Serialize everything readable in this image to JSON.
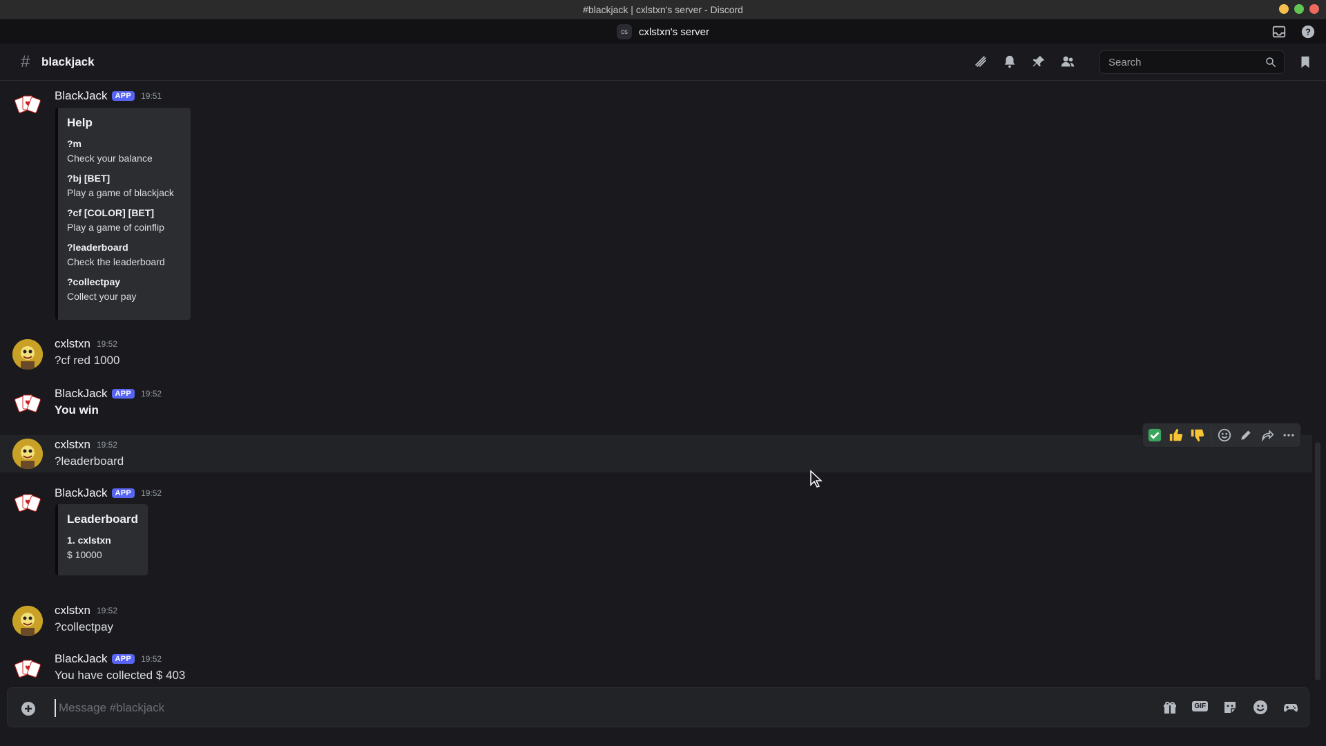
{
  "window": {
    "title": "#blackjack | cxlstxn's server - Discord"
  },
  "server": {
    "abbr": "cs",
    "name": "cxlstxn's server"
  },
  "channel": {
    "name": "blackjack"
  },
  "search": {
    "placeholder": "Search"
  },
  "composer": {
    "placeholder": "Message #blackjack"
  },
  "colors": {
    "accent": "#5865f2",
    "background": "#1a1a1e",
    "embed": "#2b2d31"
  },
  "messages": [
    {
      "author": "BlackJack",
      "badge": "APP",
      "time": "19:51",
      "embed": {
        "title": "Help",
        "fields": [
          {
            "name": "?m",
            "value": "Check your balance"
          },
          {
            "name": "?bj [BET]",
            "value": "Play a game of blackjack"
          },
          {
            "name": "?cf [COLOR] [BET]",
            "value": "Play a game of coinflip"
          },
          {
            "name": "?leaderboard",
            "value": "Check the leaderboard"
          },
          {
            "name": "?collectpay",
            "value": "Collect your pay"
          }
        ]
      }
    },
    {
      "author": "cxlstxn",
      "time": "19:52",
      "text": "?cf red 1000"
    },
    {
      "author": "BlackJack",
      "badge": "APP",
      "time": "19:52",
      "text": "You win"
    },
    {
      "author": "cxlstxn",
      "time": "19:52",
      "text": "?leaderboard"
    },
    {
      "author": "BlackJack",
      "badge": "APP",
      "time": "19:52",
      "embed": {
        "title": "Leaderboard",
        "fields": [
          {
            "name": "1. cxlstxn",
            "value": "$ 10000"
          }
        ]
      }
    },
    {
      "author": "cxlstxn",
      "time": "19:52",
      "text": "?collectpay"
    },
    {
      "author": "BlackJack",
      "badge": "APP",
      "time": "19:52",
      "text": "You have collected $ 403"
    }
  ],
  "hover_actions": {
    "icons": [
      "check-reaction-icon",
      "thumbs-up-icon",
      "thumbs-down-icon",
      "add-reaction-icon",
      "edit-icon",
      "reply-icon",
      "more-icon"
    ]
  }
}
